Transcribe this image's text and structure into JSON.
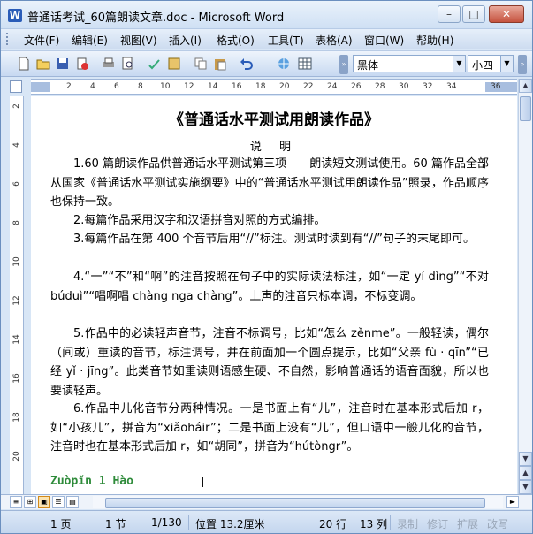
{
  "window": {
    "title": "普通话考试_60篇朗读文章.doc - Microsoft Word",
    "minimize": "–",
    "maximize": "□",
    "close": "✕"
  },
  "menu": [
    "文件(F)",
    "编辑(E)",
    "视图(V)",
    "插入(I)",
    "格式(O)",
    "工具(T)",
    "表格(A)",
    "窗口(W)",
    "帮助(H)"
  ],
  "toolbar": {
    "font": "黑体",
    "size": "小四",
    "icons": [
      "new-icon",
      "open-icon",
      "save-icon",
      "permission-icon",
      "print-icon",
      "print-preview-icon",
      "spelling-icon",
      "research-icon",
      "copy-icon",
      "paste-icon",
      "undo-icon",
      "hyperlink-icon",
      "table-icon"
    ]
  },
  "ruler": {
    "h_numbers": [
      "2",
      "4",
      "6",
      "8",
      "10",
      "12",
      "14",
      "16",
      "18",
      "20",
      "22",
      "24",
      "26",
      "28",
      "30",
      "32",
      "34",
      "36"
    ],
    "v_numbers": [
      "2",
      "4",
      "6",
      "8",
      "10",
      "12",
      "14",
      "16",
      "18",
      "20"
    ]
  },
  "document": {
    "title": "《普通话水平测试用朗读作品》",
    "subtitle": "说 明",
    "paragraphs": [
      "1.60 篇朗读作品供普通话水平测试第三项——朗读短文测试使用。60 篇作品全部从国家《普通话水平测试实施纲要》中的“普通话水平测试用朗读作品”照录，作品顺序也保持一致。",
      "2.每篇作品采用汉字和汉语拼音对照的方式编排。",
      "3.每篇作品在第 400 个音节后用“//”标注。测试时读到有“//”句子的末尾即可。",
      "4.“一”“不”和“啊”的注音按照在句子中的实际读法标注，如“一定 yí dìng”“不对 búduì”“唱啊唱 chàng nga chàng”。上声的注音只标本调，不标变调。",
      "5.作品中的必读轻声音节，注音不标调号，比如“怎么 zěnme”。一般轻读，偶尔（间或）重读的音节，标注调号，并在前面加一个圆点提示，比如“父亲 fù · qīn”“已经 yǐ · jīng”。此类音节如重读则语感生硬、不自然，影响普通话的语音面貌，所以也要读轻声。",
      "6.作品中儿化音节分两种情况。一是书面上有“儿”，注音时在基本形式后加 r，如“小孩儿”，拼音为“xiǎoháir”；二是书面上没有“儿”，但口语中一般儿化的音节，注音时也在基本形式后加 r，如“胡同”，拼音为“hútòngr”。"
    ],
    "pinyin_heading": "Zuòpǐn 1 Hào"
  },
  "status": {
    "page": "1 页",
    "section": "1 节",
    "pages": "1/130",
    "position": "位置 13.2厘米",
    "line": "20 行",
    "column": "13 列",
    "rec": "录制",
    "trk": "修订",
    "ext": "扩展",
    "ovr": "改写"
  },
  "colors": {
    "pinyin": "#2e8b3a",
    "chrome": "#d8e6f6"
  }
}
